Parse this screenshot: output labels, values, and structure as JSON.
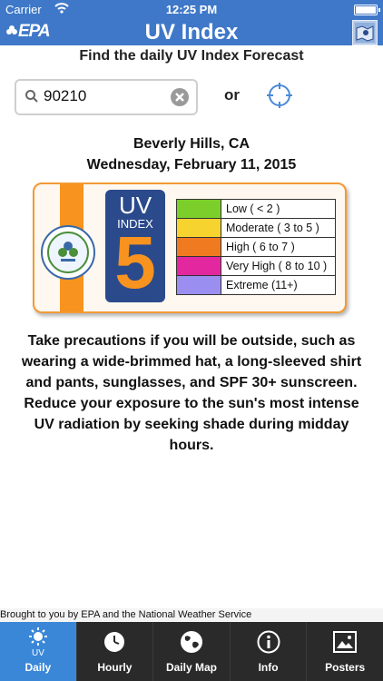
{
  "status_bar": {
    "carrier": "Carrier",
    "time": "12:25 PM"
  },
  "nav": {
    "logo": "EPA",
    "title": "UV Index",
    "map_icon": "map-icon"
  },
  "header": {
    "subtitle": "Find the daily UV Index Forecast"
  },
  "search": {
    "value": "90210",
    "or_label": "or"
  },
  "location": {
    "city": "Beverly Hills, CA",
    "date": "Wednesday, February 11, 2015"
  },
  "uv_card": {
    "uv_word": "UV",
    "index_word": "INDEX",
    "value": "5",
    "legend": [
      {
        "label": "Low  ( < 2 )",
        "color": "#7ccf2b"
      },
      {
        "label": "Moderate  ( 3 to 5 )",
        "color": "#f7d330"
      },
      {
        "label": "High  ( 6 to 7 )",
        "color": "#f07a1f"
      },
      {
        "label": "Very High  ( 8 to 10 )",
        "color": "#e2279f"
      },
      {
        "label": "Extreme  (11+)",
        "color": "#9a8ff0"
      }
    ]
  },
  "advice": "Take precautions if you will be outside, such as wearing a wide-brimmed hat, a long-sleeved shirt and pants, sunglasses, and SPF 30+ sunscreen. Reduce your exposure to the sun's most intense UV radiation by seeking shade during midday hours.",
  "credit": "Brought to you by EPA and the National Weather Service",
  "tabs": [
    {
      "label": "Daily",
      "icon": "sun-icon",
      "active": true
    },
    {
      "label": "Hourly",
      "icon": "clock-icon",
      "active": false
    },
    {
      "label": "Daily Map",
      "icon": "globe-icon",
      "active": false
    },
    {
      "label": "Info",
      "icon": "info-icon",
      "active": false
    },
    {
      "label": "Posters",
      "icon": "image-icon",
      "active": false
    }
  ]
}
